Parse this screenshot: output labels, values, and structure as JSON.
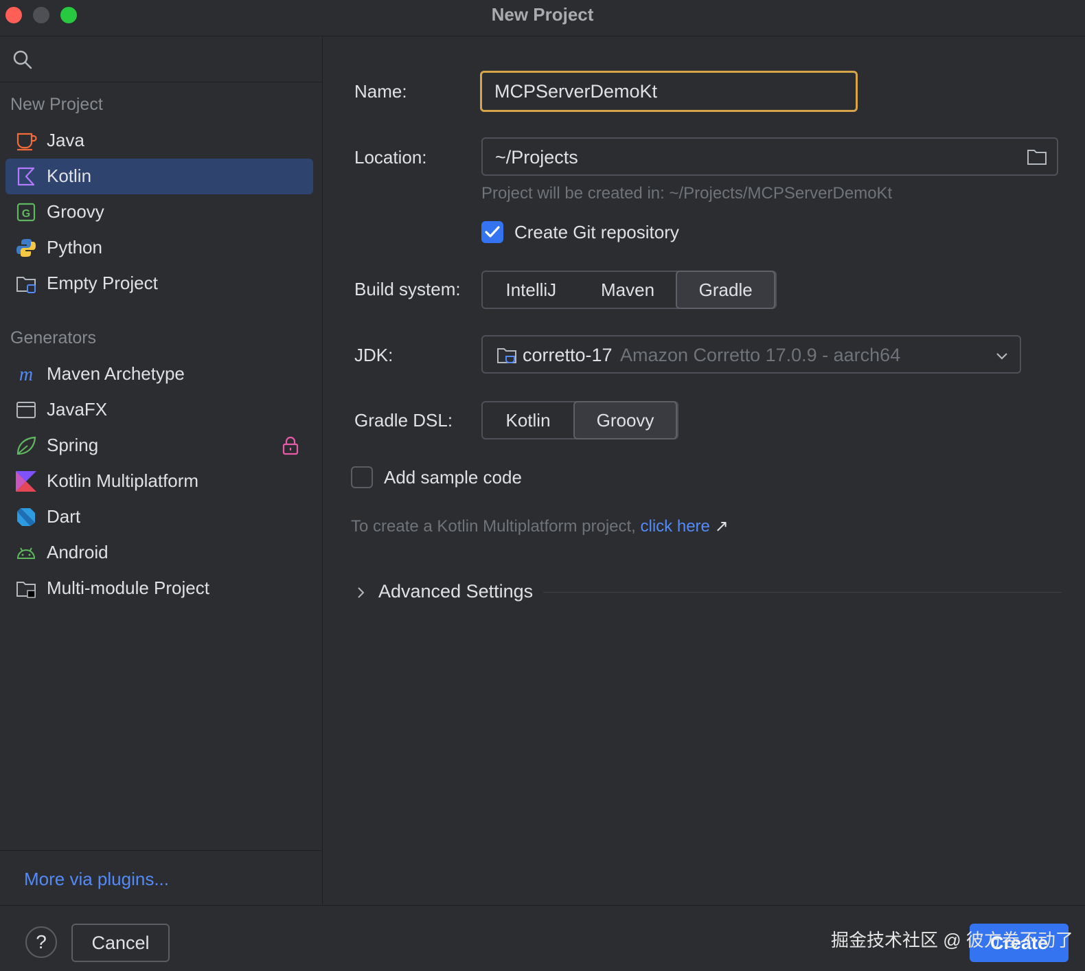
{
  "window": {
    "title": "New Project"
  },
  "sidebar": {
    "section_new": "New Project",
    "new_items": [
      {
        "label": "Java",
        "icon": "java-cup-icon"
      },
      {
        "label": "Kotlin",
        "icon": "kotlin-icon",
        "selected": true
      },
      {
        "label": "Groovy",
        "icon": "groovy-icon"
      },
      {
        "label": "Python",
        "icon": "python-icon"
      },
      {
        "label": "Empty Project",
        "icon": "empty-project-icon"
      }
    ],
    "section_generators": "Generators",
    "generator_items": [
      {
        "label": "Maven Archetype",
        "icon": "maven-icon"
      },
      {
        "label": "JavaFX",
        "icon": "javafx-window-icon"
      },
      {
        "label": "Spring",
        "icon": "spring-leaf-icon",
        "locked": true
      },
      {
        "label": "Kotlin Multiplatform",
        "icon": "kotlin-multiplatform-icon"
      },
      {
        "label": "Dart",
        "icon": "dart-icon"
      },
      {
        "label": "Android",
        "icon": "android-icon"
      },
      {
        "label": "Multi-module Project",
        "icon": "multi-module-icon"
      }
    ],
    "plugins_link": "More via plugins..."
  },
  "form": {
    "name_label": "Name:",
    "name_value": "MCPServerDemoKt",
    "location_label": "Location:",
    "location_value": "~/Projects",
    "location_hint": "Project will be created in: ~/Projects/MCPServerDemoKt",
    "git_label": "Create Git repository",
    "git_checked": true,
    "build_label": "Build system:",
    "build_options": [
      "IntelliJ",
      "Maven",
      "Gradle"
    ],
    "build_selected": "Gradle",
    "jdk_label": "JDK:",
    "jdk_name": "corretto-17",
    "jdk_desc": "Amazon Corretto 17.0.9 - aarch64",
    "dsl_label": "Gradle DSL:",
    "dsl_options": [
      "Kotlin",
      "Groovy"
    ],
    "dsl_selected": "Groovy",
    "sample_label": "Add sample code",
    "sample_checked": false,
    "kmp_hint": "To create a Kotlin Multiplatform project, ",
    "kmp_link": "click here",
    "kmp_arrow": "↗",
    "advanced_label": "Advanced Settings"
  },
  "footer": {
    "help": "?",
    "cancel": "Cancel",
    "create": "Create",
    "watermark": "掘金技术社区 @ 彼方卷不动了"
  },
  "colors": {
    "accent": "#3574f0",
    "selection": "#2e436e",
    "focus_border": "#d6a44a",
    "link": "#548af7",
    "background": "#2b2d30"
  }
}
